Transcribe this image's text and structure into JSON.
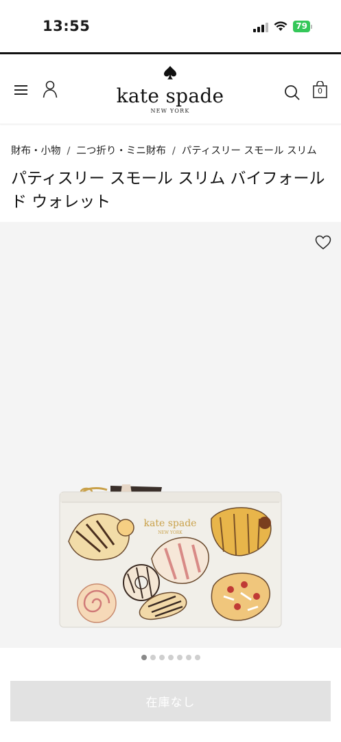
{
  "status_bar": {
    "time": "13:55",
    "battery_level": "79",
    "battery_color": "#34c759",
    "icons": [
      "cellular-signal-icon",
      "wifi-icon",
      "battery-icon"
    ]
  },
  "header": {
    "brand_name": "kate spade",
    "brand_sub": "NEW YORK",
    "cart_count": "0",
    "icons": [
      "menu-icon",
      "user-icon",
      "spade-logo-icon",
      "search-icon",
      "shopping-bag-icon"
    ]
  },
  "breadcrumb": {
    "items": [
      "財布・小物",
      "二つ折り・ミニ財布",
      "パティスリー スモール スリム"
    ],
    "separator": "/"
  },
  "product": {
    "title": "パティスリー スモール スリム バイフォールド ウォレット",
    "wallet_logo": "kate spade",
    "wallet_logo_sub": "NEW YORK",
    "image_count": 7,
    "active_image_index": 0
  },
  "actions": {
    "stock_label": "在庫なし",
    "stock_button_color": "#e2e2e2"
  }
}
